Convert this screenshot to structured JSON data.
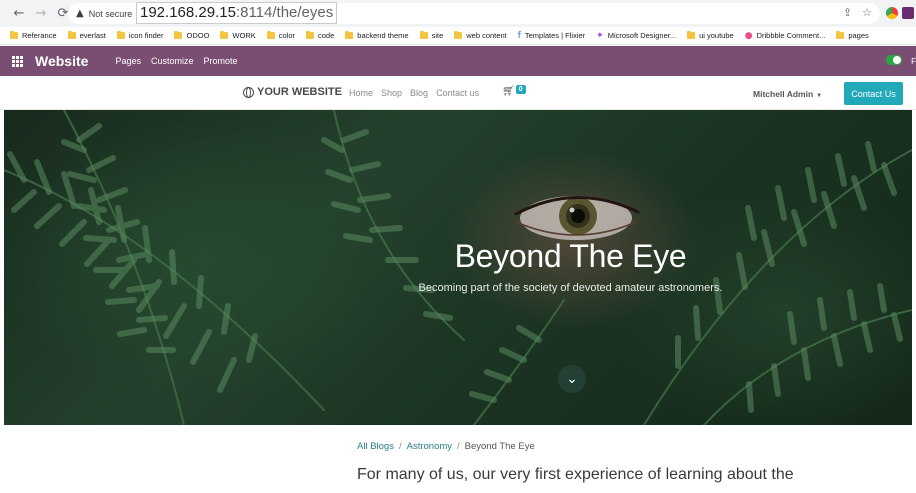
{
  "browser": {
    "security_label": "Not secure",
    "url_host": "192.168.29.15",
    "url_rest": ":8114/the/eyes",
    "bookmarks": [
      {
        "label": "Referance",
        "icon": "folder-icon"
      },
      {
        "label": "everlast",
        "icon": "folder-icon"
      },
      {
        "label": "icon finder",
        "icon": "folder-icon"
      },
      {
        "label": "ODOO",
        "icon": "folder-icon"
      },
      {
        "label": "WORK",
        "icon": "folder-icon"
      },
      {
        "label": "color",
        "icon": "folder-icon"
      },
      {
        "label": "code",
        "icon": "folder-icon"
      },
      {
        "label": "backend theme",
        "icon": "folder-icon"
      },
      {
        "label": "site",
        "icon": "folder-icon"
      },
      {
        "label": "web content",
        "icon": "folder-icon"
      },
      {
        "label": "Templates | Flixier",
        "icon": "flixier-icon"
      },
      {
        "label": "Microsoft Designer...",
        "icon": "designer-icon"
      },
      {
        "label": "ui youtube",
        "icon": "folder-icon"
      },
      {
        "label": "Dribbble Comment...",
        "icon": "dribbble-icon"
      },
      {
        "label": "pages",
        "icon": "folder-icon"
      }
    ]
  },
  "odoo_bar": {
    "brand": "Website",
    "menu": [
      "Pages",
      "Customize",
      "Promote"
    ],
    "edge_letter": "F",
    "color": "#7a4e73"
  },
  "site_header": {
    "logo_text": "YOUR WEBSITE",
    "nav": [
      "Home",
      "Shop",
      "Blog",
      "Contact us"
    ],
    "cart_count": "0",
    "user_name": "Mitchell Admin",
    "contact_button": "Contact Us",
    "accent": "#21a9b9"
  },
  "hero": {
    "title": "Beyond The Eye",
    "subtitle": "Becoming part of the society of devoted amateur astronomers."
  },
  "breadcrumb": {
    "items": [
      "All Blogs",
      "Astronomy",
      "Beyond The Eye"
    ],
    "separator": "/"
  },
  "article": {
    "lead": "For many of us, our very first experience of learning about the"
  }
}
